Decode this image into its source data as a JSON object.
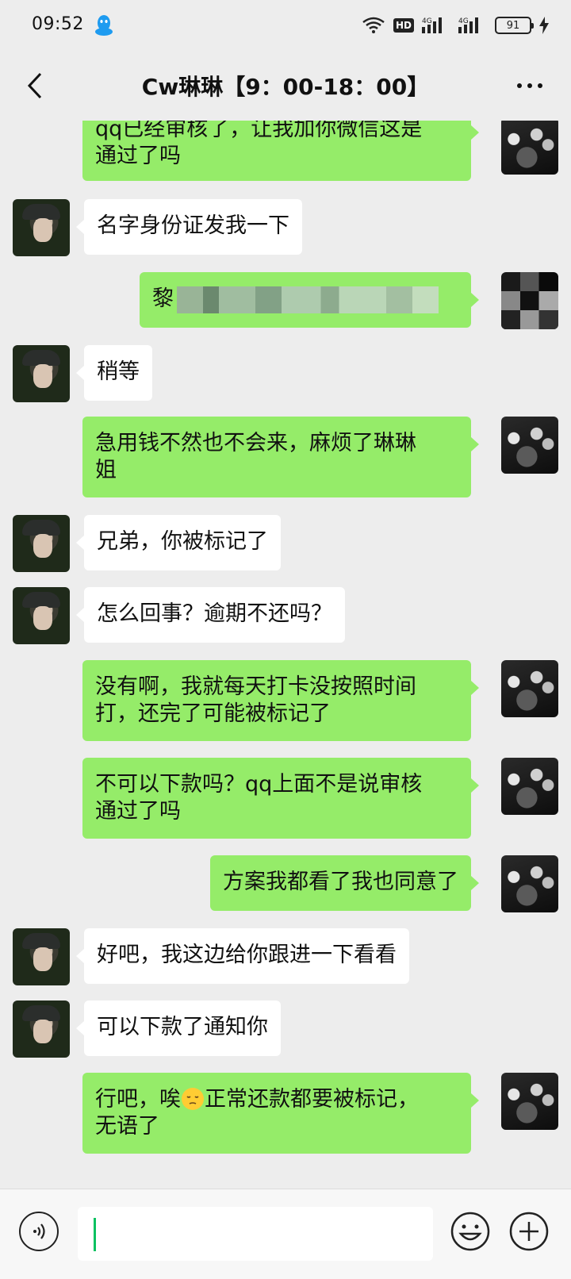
{
  "status_bar": {
    "time": "09:52",
    "network_badge": "HD",
    "signal_labels": [
      "4G",
      "4G"
    ],
    "battery": "91"
  },
  "header": {
    "title": "Cw琳琳【9：00-18：00】"
  },
  "messages": [
    {
      "side": "right",
      "text_line1": "qq已经审核了，让我加你微信这是",
      "text_line2": "通过了吗"
    },
    {
      "side": "left",
      "text": "名字身份证发我一下"
    },
    {
      "side": "right",
      "text_visible": "黎"
    },
    {
      "side": "left",
      "text": "稍等"
    },
    {
      "side": "right",
      "text_line1": "急用钱不然也不会来，麻烦了琳琳",
      "text_line2": "姐"
    },
    {
      "side": "left",
      "text": "兄弟，你被标记了"
    },
    {
      "side": "left",
      "text": "怎么回事？逾期不还吗？"
    },
    {
      "side": "right",
      "text_line1": "没有啊，我就每天打卡没按照时间",
      "text_line2": "打，还完了可能被标记了"
    },
    {
      "side": "right",
      "text_line1": "不可以下款吗？qq上面不是说审核",
      "text_line2": "通过了吗"
    },
    {
      "side": "right",
      "text": "方案我都看了我也同意了"
    },
    {
      "side": "left",
      "text": "好吧，我这边给你跟进一下看看"
    },
    {
      "side": "left",
      "text": "可以下款了通知你"
    },
    {
      "side": "right",
      "text_line1a": "行吧，唉",
      "emoji": "pensive-face",
      "text_line1b": "正常还款都要被标记，",
      "text_line2": "无语了"
    }
  ],
  "input": {
    "value": ""
  },
  "colors": {
    "background": "#ededed",
    "my_bubble": "#95ec69",
    "their_bubble": "#ffffff",
    "caret": "#07c160"
  },
  "icons": {
    "back": "chevron-left-icon",
    "more": "ellipsis-icon",
    "voice": "voice-icon",
    "emoji": "smiley-icon",
    "plus": "plus-icon"
  }
}
